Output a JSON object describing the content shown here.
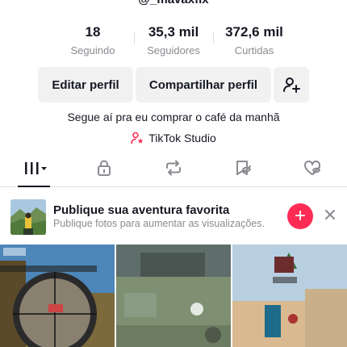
{
  "profile": {
    "username": "@_mavaxflx"
  },
  "stats": [
    {
      "value": "18",
      "label": "Seguindo"
    },
    {
      "value": "35,3 mil",
      "label": "Seguidores"
    },
    {
      "value": "372,6 mil",
      "label": "Curtidas"
    }
  ],
  "buttons": {
    "edit": "Editar perfil",
    "share": "Compartilhar perfil"
  },
  "bio": "Segue aí pra eu comprar o café da manhã",
  "studio_link": "TikTok Studio",
  "promo": {
    "title": "Publique sua aventura favorita",
    "subtitle": "Publique fotos para aumentar as visualizações."
  },
  "tabs": [
    "videos-grid-icon",
    "lock-icon",
    "repost-icon",
    "saved-icon",
    "liked-icon"
  ],
  "colors": {
    "accent": "#fe2c55",
    "text": "#161823",
    "muted": "#8a8b91",
    "button_bg": "#f1f1f2"
  }
}
